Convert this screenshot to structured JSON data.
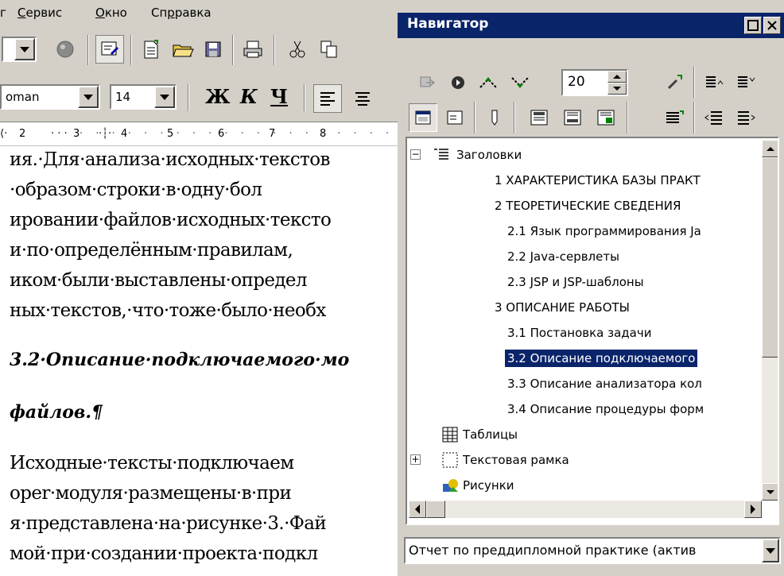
{
  "writer": {
    "menu": [
      {
        "label": "г",
        "underline": ""
      },
      {
        "label": "ервис",
        "underline": "С"
      },
      {
        "label": "кно",
        "underline": "О"
      },
      {
        "label": "Сп",
        "underline": "",
        "rest": "равка",
        "ul_mid": "р"
      }
    ],
    "font_name": "oman",
    "font_size": "14",
    "format_buttons": {
      "bold": "Ж",
      "italic": "К",
      "underline": "Ч"
    },
    "ruler": [
      "2",
      "3",
      "4",
      "5",
      "6",
      "7",
      "8"
    ],
    "document_lines": [
      "ия.·Для·анализа·исходных·текстов",
      "·образом·строки·в·одну·бол",
      "ировании·файлов·исходных·тексто",
      "и·по·определённым·правилам,",
      "иком·были·выставлены·определ",
      "ных·текстов,·что·тоже·было·необх"
    ],
    "heading_line1": "3.2·Описание·подключаемого·мо",
    "heading_line2": "файлов.¶",
    "document_lines2": [
      "Исходные·тексты·подключаем",
      "oper·модуля·размещены·в·при",
      "я·представлена·на·рисунке·3.·Фай",
      "мой·при·создании·проекта·подкл"
    ]
  },
  "navigator": {
    "title": "Навигатор",
    "spin_value": "20",
    "tree": [
      {
        "label": "Заголовки",
        "level": 0,
        "expander": "−",
        "icon": "headings-icon"
      },
      {
        "label": "1 ХАРАКТЕРИСТИКА БАЗЫ ПРАКТ",
        "level": 1
      },
      {
        "label": "2 ТЕОРЕТИЧЕСКИЕ СВЕДЕНИЯ",
        "level": 1
      },
      {
        "label": "2.1 Язык программирования Ja",
        "level": 2
      },
      {
        "label": "2.2 Java-сервлеты",
        "level": 2
      },
      {
        "label": "2.3 JSP и JSP-шаблоны",
        "level": 2
      },
      {
        "label": "3 ОПИСАНИЕ РАБОТЫ",
        "level": 1
      },
      {
        "label": "3.1 Постановка задачи",
        "level": 2
      },
      {
        "label": "3.2 Описание подключаемого",
        "level": 2,
        "selected": true
      },
      {
        "label": "3.3 Описание анализатора кол",
        "level": 2
      },
      {
        "label": "3.4 Описание процедуры форм",
        "level": 2
      },
      {
        "label": "Таблицы",
        "level": 0,
        "icon": "table-icon"
      },
      {
        "label": "Текстовая рамка",
        "level": 0,
        "expander": "+",
        "icon": "text-frame-icon"
      },
      {
        "label": "Рисунки",
        "level": 0,
        "icon": "pictures-icon"
      }
    ],
    "document_select": "Отчет по преддипломной практике (актив"
  },
  "colors": {
    "titlebar": "#0a246a",
    "face": "#d4d0c8",
    "selection": "#0a246a"
  }
}
